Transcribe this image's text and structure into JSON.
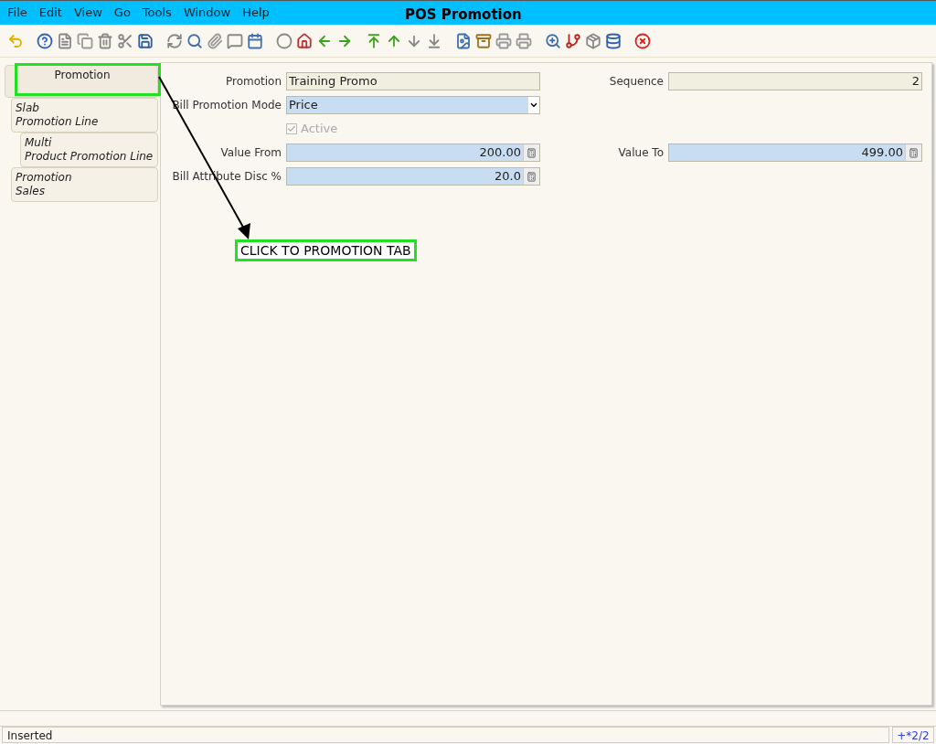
{
  "window": {
    "title": "POS Promotion"
  },
  "menu": [
    "File",
    "Edit",
    "View",
    "Go",
    "Tools",
    "Window",
    "Help"
  ],
  "tabs": [
    {
      "label": "Promotion",
      "selected": true,
      "children": [
        {
          "label": "Slab\nPromotion Line",
          "selected": false,
          "children": [
            {
              "label": "Multi\nProduct Promotion Line",
              "selected": false
            }
          ]
        },
        {
          "label": "Promotion\nSales",
          "selected": false
        }
      ]
    }
  ],
  "form": {
    "rows": [
      {
        "left": {
          "kind": "text",
          "label": "Promotion",
          "value": "Training Promo",
          "readonly": true
        },
        "right": {
          "kind": "number",
          "label": "Sequence",
          "value": "2",
          "readonly": true
        }
      },
      {
        "left": {
          "kind": "combo",
          "label": "Bill Promotion Mode",
          "value": "Price",
          "readonly": false
        }
      },
      {
        "left": {
          "kind": "checkbox",
          "label": "Active",
          "checked": true,
          "disabled": true
        }
      },
      {
        "left": {
          "kind": "calc",
          "label": "Value From",
          "value": "200.00",
          "readonly": false
        },
        "right": {
          "kind": "calc",
          "label": "Value To",
          "value": "499.00",
          "readonly": false
        }
      },
      {
        "left": {
          "kind": "calc",
          "label": "Bill Attribute Disc %",
          "value": "20.0",
          "readonly": false
        }
      }
    ]
  },
  "callout": {
    "text": "CLICK TO PROMOTION TAB"
  },
  "status_bar": {
    "message": "Inserted",
    "record": "+*2/2"
  }
}
